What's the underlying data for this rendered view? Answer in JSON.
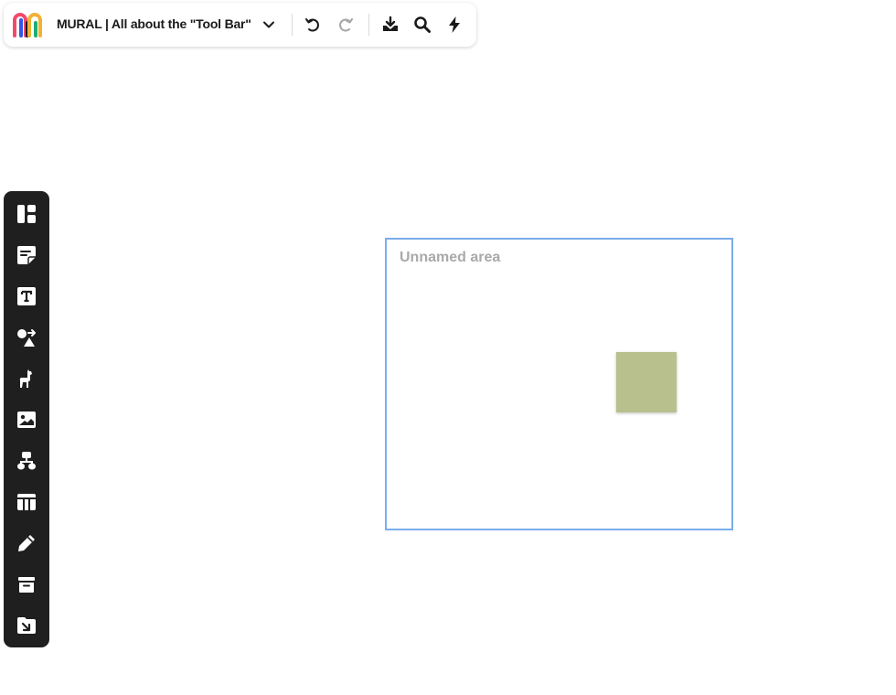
{
  "header": {
    "title": "MURAL | All about the \"Tool Bar\"",
    "logo_icon": "mural-logo-icon",
    "buttons": [
      {
        "icon": "chevron-down-icon"
      },
      {
        "icon": "undo-icon"
      },
      {
        "icon": "redo-icon",
        "state": "disabled"
      },
      {
        "icon": "download-icon"
      },
      {
        "icon": "search-icon"
      },
      {
        "icon": "lightning-icon"
      }
    ]
  },
  "sidebar": {
    "items": [
      {
        "icon": "templates-icon"
      },
      {
        "icon": "sticky-note-icon"
      },
      {
        "icon": "text-icon"
      },
      {
        "icon": "shapes-connectors-icon"
      },
      {
        "icon": "llama-icon"
      },
      {
        "icon": "image-icon"
      },
      {
        "icon": "diagram-icon"
      },
      {
        "icon": "table-icon"
      },
      {
        "icon": "pencil-icon"
      },
      {
        "icon": "archive-icon"
      },
      {
        "icon": "import-icon"
      }
    ]
  },
  "canvas": {
    "area": {
      "label": "Unnamed area",
      "border_color": "#7aacea"
    },
    "sticky_note": {
      "color": "#b8c08e",
      "text": ""
    }
  },
  "colors": {
    "sidebar_bg": "#1f1f1f",
    "icon_dark": "#1a1a1a",
    "icon_disabled": "#a6a6a6",
    "area_label": "#a9a9a9"
  }
}
